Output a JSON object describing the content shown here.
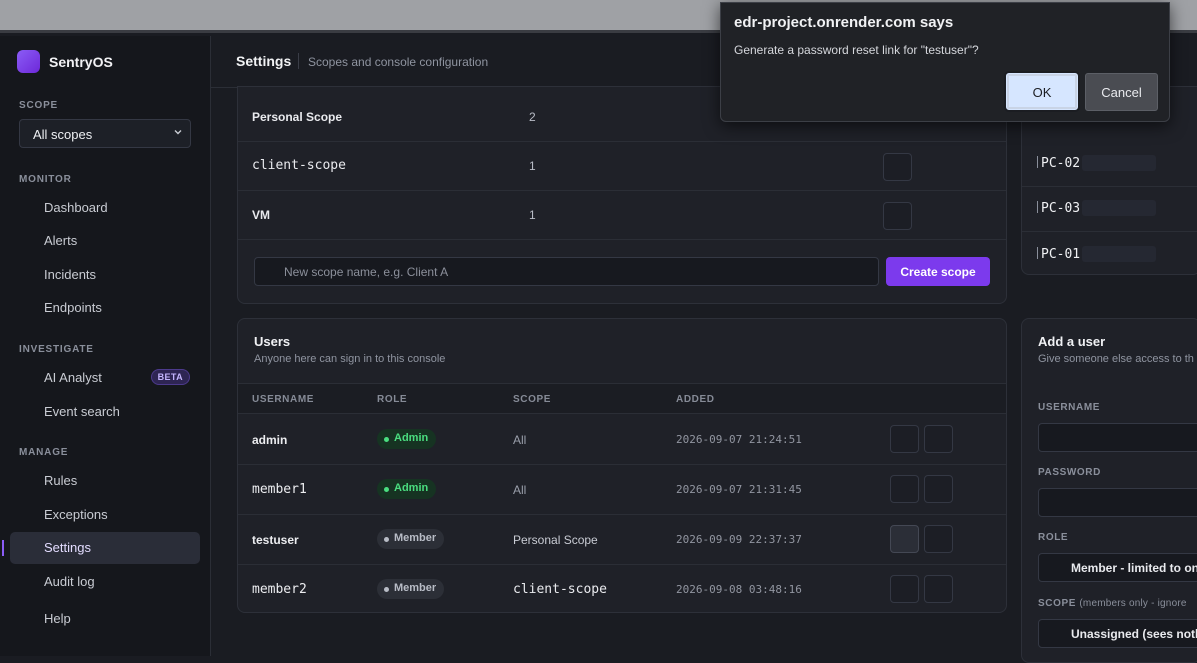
{
  "app": {
    "name": "SentryOS"
  },
  "sidebar": {
    "scope_label": "SCOPE",
    "scope_value": "All scopes",
    "sections": {
      "monitor": "MONITOR",
      "investigate": "INVESTIGATE",
      "manage": "MANAGE"
    },
    "items": {
      "dashboard": "Dashboard",
      "alerts": "Alerts",
      "incidents": "Incidents",
      "endpoints": "Endpoints",
      "ai_analyst": "AI Analyst",
      "ai_badge": "BETA",
      "event_search": "Event search",
      "rules": "Rules",
      "exceptions": "Exceptions",
      "settings": "Settings",
      "audit_log": "Audit log",
      "help": "Help"
    },
    "active_item": "settings"
  },
  "header": {
    "title": "Settings",
    "subtitle": "Scopes and console configuration"
  },
  "scopes": {
    "rows": [
      {
        "name": "Personal Scope",
        "count": "2"
      },
      {
        "name": "client-scope",
        "count": "1"
      },
      {
        "name": "VM",
        "count": "1"
      }
    ],
    "new_placeholder": "New scope name, e.g. Client A",
    "create_label": "Create scope"
  },
  "users": {
    "title": "Users",
    "subtitle": "Anyone here can sign in to this console",
    "columns": {
      "username": "USERNAME",
      "role": "ROLE",
      "scope": "SCOPE",
      "added": "ADDED"
    },
    "rows": [
      {
        "username": "admin",
        "role": "Admin",
        "scope": "All",
        "added": "2026-09-07 21:24:51"
      },
      {
        "username": "member1",
        "role": "Admin",
        "scope": "All",
        "added": "2026-09-07 21:31:45"
      },
      {
        "username": "testuser",
        "role": "Member",
        "scope": "Personal Scope",
        "added": "2026-09-09 22:37:37"
      },
      {
        "username": "member2",
        "role": "Member",
        "scope": "client-scope",
        "added": "2026-09-08 03:48:16"
      }
    ]
  },
  "hosts": {
    "rows": [
      "PC-02",
      "PC-03",
      "PC-01"
    ]
  },
  "add_user": {
    "title": "Add a user",
    "subtitle": "Give someone else access to th",
    "username_label": "USERNAME",
    "password_label": "PASSWORD",
    "role_label": "ROLE",
    "role_value": "Member - limited to on",
    "scope_label": "SCOPE",
    "scope_hint": "(members only - ignore",
    "scope_value": "Unassigned (sees noth"
  },
  "dialog": {
    "title": "edr-project.onrender.com says",
    "message": "Generate a password reset link for \"testuser\"?",
    "ok": "OK",
    "cancel": "Cancel"
  },
  "colors": {
    "accent": "#7c3aed",
    "admin": "#4ade80",
    "background": "#1a1c22"
  }
}
